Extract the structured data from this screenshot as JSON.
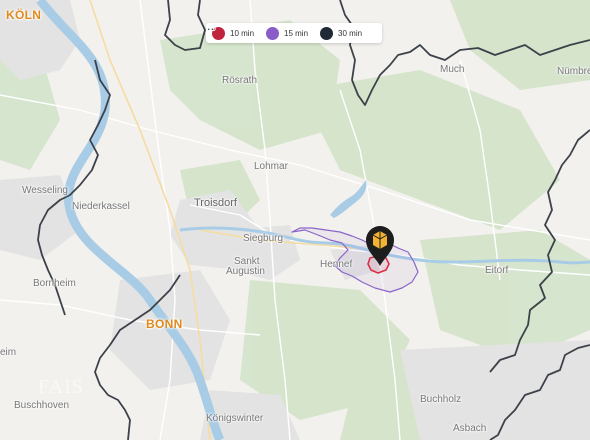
{
  "map": {
    "places": {
      "koeln": "KÖLN",
      "bonn": "BONN",
      "troisdorf": "Troisdorf",
      "siegburg": "Siegburg",
      "sankt_augustin_1": "Sankt",
      "sankt_augustin_2": "Augustin",
      "hennef": "Hennef",
      "eitorf": "Eitorf",
      "lohmar": "Lohmar",
      "roesrath": "Rösrath",
      "much": "Much",
      "nuembrecht": "Nümbre",
      "wesseling": "Wesseling",
      "niederkassel": "Niederkassel",
      "bornheim": "Bornheim",
      "buschhoven": "Buschhoven",
      "koenigswinter": "Königswinter",
      "buchholz": "Buchholz",
      "asbach": "Asbach",
      "heim": "eim"
    },
    "watermark": "FAIS"
  },
  "legend": {
    "items": [
      {
        "label": "10 min",
        "icon": "walking-icon",
        "color": "#c0243c"
      },
      {
        "label": "15 min",
        "icon": "bicycle-icon",
        "color": "#8a5cc8"
      },
      {
        "label": "30 min",
        "icon": "car-icon",
        "color": "#1f2a36"
      }
    ]
  },
  "colors": {
    "walk_isochrone": "#d9304a",
    "bike_isochrone": "#8a64c8",
    "car_isochrone": "#3d4149",
    "water": "#a9cce6",
    "forest": "#cfe0c6",
    "urban": "#e4e4e4",
    "marker": "#1d1d1d",
    "marker_accent": "#f2b233"
  }
}
